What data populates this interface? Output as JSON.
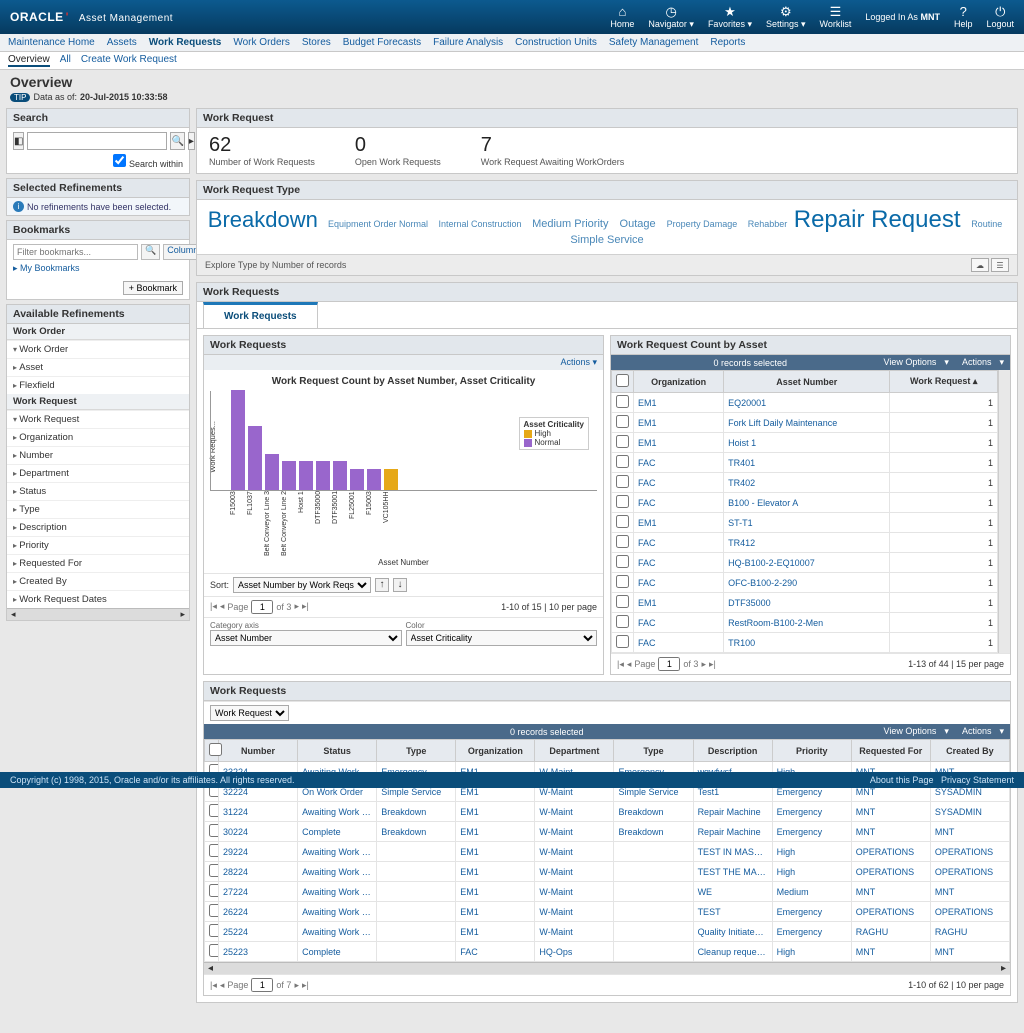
{
  "app": {
    "brand": "ORACLE",
    "product": "Asset Management",
    "logged_in_label": "Logged In As",
    "logged_in_user": "MNT"
  },
  "topnav": {
    "home": "Home",
    "navigator": "Navigator",
    "favorites": "Favorites",
    "settings": "Settings",
    "worklist": "Worklist",
    "help": "Help",
    "logout": "Logout"
  },
  "menubar": {
    "items": [
      "Maintenance Home",
      "Assets",
      "Work Requests",
      "Work Orders",
      "Stores",
      "Budget Forecasts",
      "Failure Analysis",
      "Construction Units",
      "Safety Management",
      "Reports"
    ],
    "active_index": 2
  },
  "submenubar": {
    "items": [
      "Overview",
      "All",
      "Create Work Request"
    ],
    "active_index": 0
  },
  "page_title": "Overview",
  "tip": {
    "label": "TIP",
    "prefix": "Data as of:",
    "value": "20-Jul-2015 10:33:58"
  },
  "search": {
    "heading": "Search",
    "tooltip": "Search",
    "search_within_label": "Search within",
    "search_within_checked": true
  },
  "selected_refinements": {
    "heading": "Selected Refinements",
    "none_text": "No refinements have been selected."
  },
  "bookmarks": {
    "heading": "Bookmarks",
    "filter_placeholder": "Filter bookmarks...",
    "columns_label": "Columns",
    "my_bookmarks": "My Bookmarks",
    "add_button": "+ Bookmark"
  },
  "available_refinements": {
    "heading": "Available Refinements",
    "group_work_order": "Work Order",
    "items_work_order": [
      "Work Order",
      "Asset",
      "Flexfield"
    ],
    "group_work_request": "Work Request",
    "items_work_request": [
      "Work Request",
      "Organization",
      "Number",
      "Department",
      "Status",
      "Type",
      "Description",
      "Priority",
      "Requested For",
      "Created By",
      "Work Request Dates"
    ]
  },
  "summary": {
    "heading": "Work Request",
    "metrics": [
      {
        "num": "62",
        "lab": "Number of Work Requests"
      },
      {
        "num": "0",
        "lab": "Open Work Requests"
      },
      {
        "num": "7",
        "lab": "Work Request Awaiting WorkOrders"
      }
    ]
  },
  "typecloud": {
    "heading": "Work Request Type",
    "items": [
      {
        "t": "Breakdown",
        "cls": "big1"
      },
      {
        "t": "Equipment Order Normal",
        "cls": "sm"
      },
      {
        "t": "Internal Construction",
        "cls": "sm"
      },
      {
        "t": "Medium Priority",
        "cls": "mid"
      },
      {
        "t": "Outage",
        "cls": "mid"
      },
      {
        "t": "Property Damage",
        "cls": "sm"
      },
      {
        "t": "Rehabber",
        "cls": "sm"
      },
      {
        "t": "Repair Request",
        "cls": "big2"
      },
      {
        "t": "Routine",
        "cls": "sm"
      },
      {
        "t": "Simple Service",
        "cls": "mid"
      }
    ],
    "explore_label": "Explore Type by Number of records"
  },
  "tabs_section": {
    "heading": "Work Requests",
    "tab_label": "Work Requests"
  },
  "chart_panel": {
    "heading": "Work Requests",
    "actions_label": "Actions",
    "sort_label": "Sort:",
    "sort_value": "Asset Number by Work Reqs",
    "page_label": "Page",
    "page_current": "1",
    "page_total": "of 3",
    "page_info_right": "1-10 of 15  |  10 per page",
    "category_axis_label": "Category axis",
    "category_axis_value": "Asset Number",
    "color_label": "Color",
    "color_value": "Asset Criticality"
  },
  "chart_data": {
    "type": "bar",
    "title": "Work Request Count by Asset Number, Asset Criticality",
    "xlabel": "Asset Number",
    "ylabel": "Work Reques...",
    "ylim": [
      0,
      14
    ],
    "legend_title": "Asset Criticality",
    "legend": [
      {
        "name": "High",
        "color": "#e6a817"
      },
      {
        "name": "Normal",
        "color": "#9966cc"
      }
    ],
    "categories": [
      "F15003",
      "FL1037",
      "Belt Conveyor Line 3",
      "Belt Conveyor Line 2",
      "Hoist 1",
      "DTF35000",
      "DTF35001",
      "FL25001",
      "F15003",
      "VC105HH"
    ],
    "series": [
      {
        "name": "Normal",
        "values": [
          14,
          9,
          5,
          4,
          4,
          4,
          4,
          3,
          3,
          0
        ]
      },
      {
        "name": "High",
        "values": [
          0,
          0,
          0,
          0,
          0,
          0,
          0,
          0,
          0,
          3
        ]
      }
    ]
  },
  "asset_count": {
    "heading": "Work Request Count by Asset",
    "records_selected": "0 records selected",
    "view_options": "View Options",
    "actions": "Actions",
    "columns": [
      "Organization",
      "Asset Number",
      "Work Request"
    ],
    "sort_col_index": 2,
    "rows": [
      {
        "org": "EM1",
        "asset": "EQ20001",
        "wr": "1"
      },
      {
        "org": "EM1",
        "asset": "Fork Lift Daily Maintenance",
        "wr": "1"
      },
      {
        "org": "EM1",
        "asset": "Hoist 1",
        "wr": "1"
      },
      {
        "org": "FAC",
        "asset": "TR401",
        "wr": "1"
      },
      {
        "org": "FAC",
        "asset": "TR402",
        "wr": "1"
      },
      {
        "org": "FAC",
        "asset": "B100 - Elevator A",
        "wr": "1"
      },
      {
        "org": "EM1",
        "asset": "ST-T1",
        "wr": "1"
      },
      {
        "org": "FAC",
        "asset": "TR412",
        "wr": "1"
      },
      {
        "org": "FAC",
        "asset": "HQ-B100-2-EQ10007",
        "wr": "1"
      },
      {
        "org": "FAC",
        "asset": "OFC-B100-2-290",
        "wr": "1"
      },
      {
        "org": "EM1",
        "asset": "DTF35000",
        "wr": "1"
      },
      {
        "org": "FAC",
        "asset": "RestRoom-B100-2-Men",
        "wr": "1"
      },
      {
        "org": "FAC",
        "asset": "TR100",
        "wr": "1"
      }
    ],
    "page_label": "Page",
    "page_current": "1",
    "page_total": "of 3",
    "page_info_right": "1-13 of 44  |  15 per page"
  },
  "wr_table": {
    "heading": "Work Requests",
    "filter_value": "Work Request",
    "records_selected": "0 records selected",
    "view_options": "View Options",
    "actions": "Actions",
    "columns": [
      "Number",
      "Status",
      "Type",
      "Organization",
      "Department",
      "Type",
      "Description",
      "Priority",
      "Requested For",
      "Created By"
    ],
    "rows": [
      {
        "n": "33224",
        "s": "Awaiting Work Order",
        "t1": "Emergency",
        "o": "EM1",
        "d": "W-Maint",
        "t2": "Emergency",
        "de": "wqwfwsf",
        "p": "High",
        "rf": "MNT",
        "cb": "MNT"
      },
      {
        "n": "32224",
        "s": "On Work Order",
        "t1": "Simple Service",
        "o": "EM1",
        "d": "W-Maint",
        "t2": "Simple Service",
        "de": "Test1",
        "p": "Emergency",
        "rf": "MNT",
        "cb": "SYSADMIN"
      },
      {
        "n": "31224",
        "s": "Awaiting Work Order",
        "t1": "Breakdown",
        "o": "EM1",
        "d": "W-Maint",
        "t2": "Breakdown",
        "de": "Repair Machine",
        "p": "Emergency",
        "rf": "MNT",
        "cb": "SYSADMIN"
      },
      {
        "n": "30224",
        "s": "Complete",
        "t1": "Breakdown",
        "o": "EM1",
        "d": "W-Maint",
        "t2": "Breakdown",
        "de": "Repair Machine",
        "p": "Emergency",
        "rf": "MNT",
        "cb": "MNT"
      },
      {
        "n": "29224",
        "s": "Awaiting Work Order",
        "t1": "",
        "o": "EM1",
        "d": "W-Maint",
        "t2": "",
        "de": "TEST IN MASTER...",
        "p": "High",
        "rf": "OPERATIONS",
        "cb": "OPERATIONS"
      },
      {
        "n": "28224",
        "s": "Awaiting Work Order",
        "t1": "",
        "o": "EM1",
        "d": "W-Maint",
        "t2": "",
        "de": "TEST THE MASTER",
        "p": "High",
        "rf": "OPERATIONS",
        "cb": "OPERATIONS"
      },
      {
        "n": "27224",
        "s": "Awaiting Work Order",
        "t1": "",
        "o": "EM1",
        "d": "W-Maint",
        "t2": "",
        "de": "WE",
        "p": "Medium",
        "rf": "MNT",
        "cb": "MNT"
      },
      {
        "n": "26224",
        "s": "Awaiting Work Order",
        "t1": "",
        "o": "EM1",
        "d": "W-Maint",
        "t2": "",
        "de": "TEST",
        "p": "Emergency",
        "rf": "OPERATIONS",
        "cb": "OPERATIONS"
      },
      {
        "n": "25224",
        "s": "Awaiting Work Order",
        "t1": "",
        "o": "EM1",
        "d": "W-Maint",
        "t2": "",
        "de": "Quality Initiated W...",
        "p": "Emergency",
        "rf": "RAGHU",
        "cb": "RAGHU"
      },
      {
        "n": "25223",
        "s": "Complete",
        "t1": "",
        "o": "FAC",
        "d": "HQ-Ops",
        "t2": "",
        "de": "Cleanup request –...",
        "p": "High",
        "rf": "MNT",
        "cb": "MNT"
      }
    ],
    "page_label": "Page",
    "page_current": "1",
    "page_total": "of 7",
    "page_info_right": "1-10 of 62  |  10 per page"
  },
  "footer": {
    "copyright": "Copyright (c) 1998, 2015, Oracle and/or its affiliates. All rights reserved.",
    "about": "About this Page",
    "privacy": "Privacy Statement"
  }
}
